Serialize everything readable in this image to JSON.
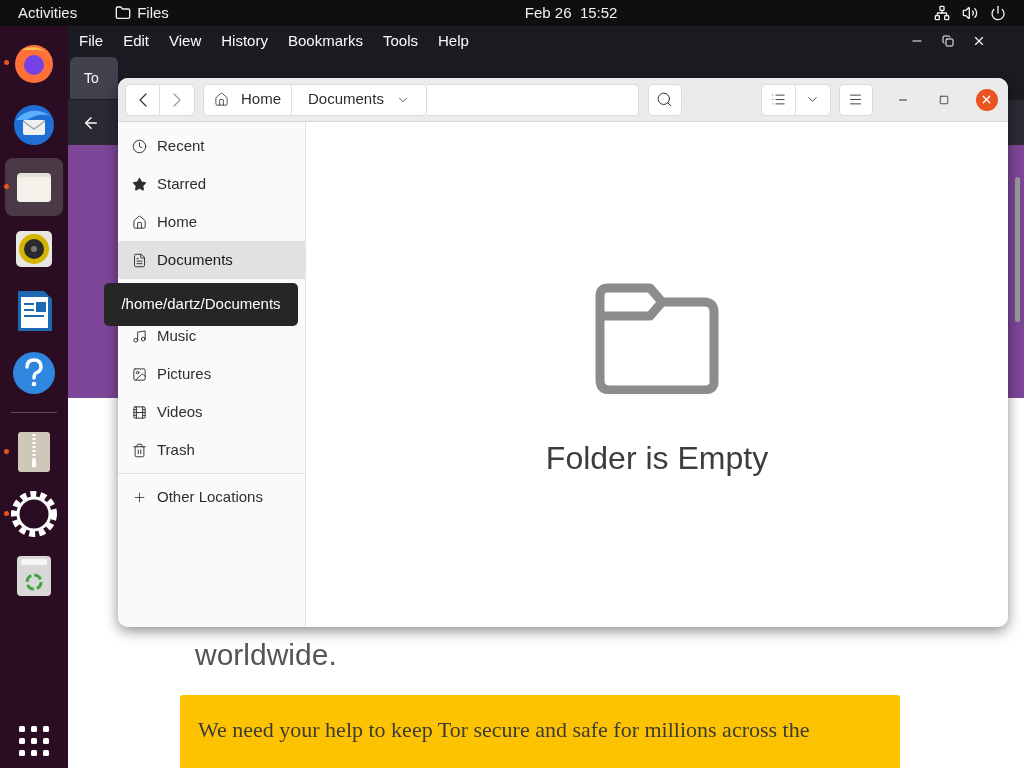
{
  "top_bar": {
    "activities": "Activities",
    "app": "Files",
    "clock": "Feb 26  15:52"
  },
  "dock": {
    "groups": [
      {
        "apps": [
          {
            "kind": "firefox",
            "running": true,
            "selected": false
          },
          {
            "kind": "thunderbird",
            "running": false,
            "selected": false
          },
          {
            "kind": "files",
            "running": true,
            "selected": true
          },
          {
            "kind": "rhythmbox",
            "running": false,
            "selected": false
          },
          {
            "kind": "writer",
            "running": false,
            "selected": false
          },
          {
            "kind": "help",
            "running": false,
            "selected": false
          }
        ]
      },
      {
        "apps": [
          {
            "kind": "archive",
            "running": true,
            "selected": false
          },
          {
            "kind": "settings",
            "running": true,
            "selected": false
          },
          {
            "kind": "trash",
            "running": false,
            "selected": false
          }
        ]
      }
    ]
  },
  "browser": {
    "menu": [
      "File",
      "Edit",
      "View",
      "History",
      "Bookmarks",
      "Tools",
      "Help"
    ],
    "tab": {
      "label": "To"
    },
    "page": {
      "text": "worldwide.",
      "banner": "We need your help to keep Tor secure and safe for millions across the"
    }
  },
  "files": {
    "path": [
      {
        "label": "Home",
        "kind": "home"
      },
      {
        "label": "Documents",
        "kind": "folder"
      }
    ],
    "sidebar": {
      "places": [
        {
          "label": "Recent",
          "kind": "place",
          "selected": false
        },
        {
          "label": "Starred",
          "kind": "place",
          "selected": false
        },
        {
          "label": "Home",
          "kind": "place",
          "selected": false
        },
        {
          "label": "Documents",
          "kind": "place",
          "selected": true
        },
        {
          "kind": "covered"
        },
        {
          "label": "Music",
          "kind": "place",
          "selected": false
        },
        {
          "label": "Pictures",
          "kind": "place",
          "selected": false
        },
        {
          "label": "Videos",
          "kind": "place",
          "selected": false
        },
        {
          "label": "Trash",
          "kind": "place",
          "selected": false
        }
      ],
      "other": {
        "label": "Other Locations"
      }
    },
    "tooltip": "/home/dartz/Documents",
    "empty_message": "Folder is Empty"
  }
}
